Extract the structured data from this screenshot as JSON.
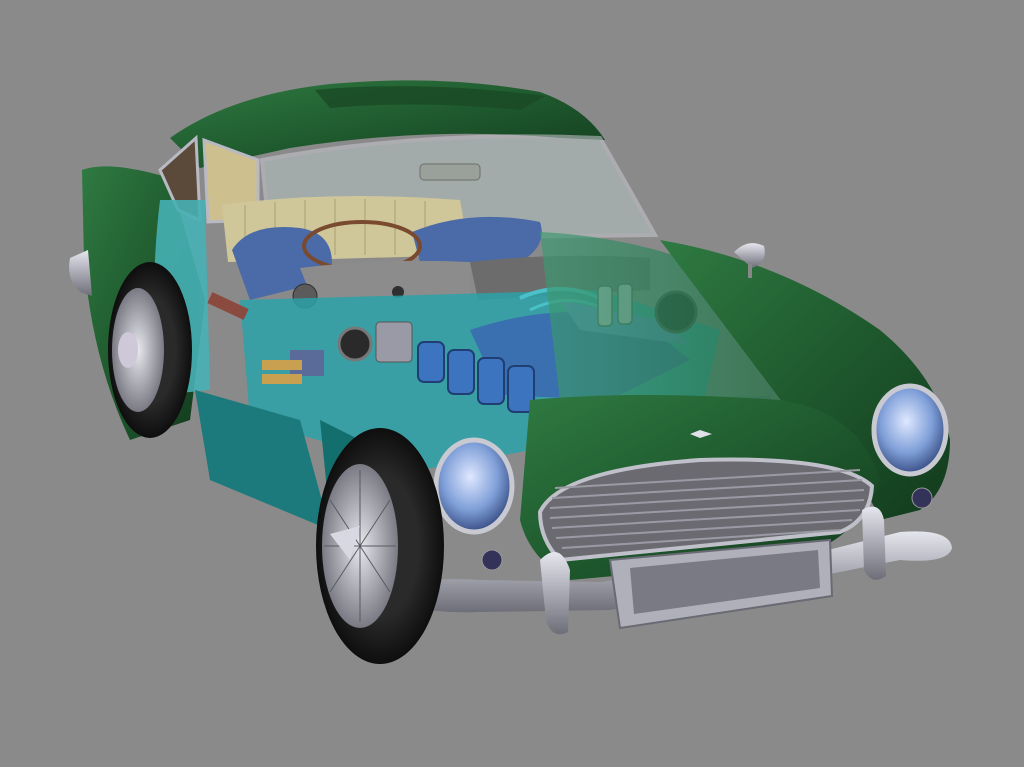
{
  "scene": {
    "subject": "cutaway-render",
    "colors": {
      "background": "#8a8a8a",
      "body_green": "#1f5a2e",
      "body_green_light": "#3f8a52",
      "interior_teal": "#2aa2a8",
      "engine_blue": "#3a6fb0",
      "chrome": "#b9b9c4",
      "tire": "#1a1a1a",
      "seat_blue": "#4b6aa8",
      "interior_cream": "#cfc79a"
    }
  }
}
